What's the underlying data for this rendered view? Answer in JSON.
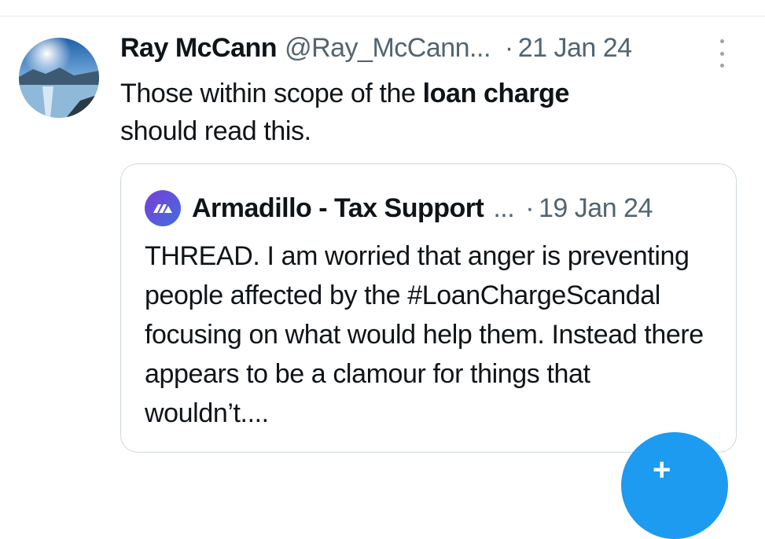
{
  "tweet": {
    "author_name": "Ray McCann",
    "handle": "@Ray_McCann...",
    "separator": "·",
    "date": "21 Jan 24",
    "text_before": "Those within scope of the ",
    "text_bold": "loan charge",
    "text_after": " should read this."
  },
  "quote": {
    "author_name": "Armadillo - Tax Support",
    "ellipsis": "...",
    "separator": "·",
    "date": "19 Jan 24",
    "text": "THREAD. I am worried that anger is preventing people affected by the #LoanChargeScandal focusing on what would help them. Instead there appears to be a clamour for things that wouldn’t...."
  },
  "colors": {
    "primary_text": "#0f1419",
    "secondary_text": "#536471",
    "border": "#cfd9de",
    "accent": "#1d9bf0"
  },
  "icons": {
    "more": "more-vertical-icon",
    "compose": "compose-icon"
  }
}
